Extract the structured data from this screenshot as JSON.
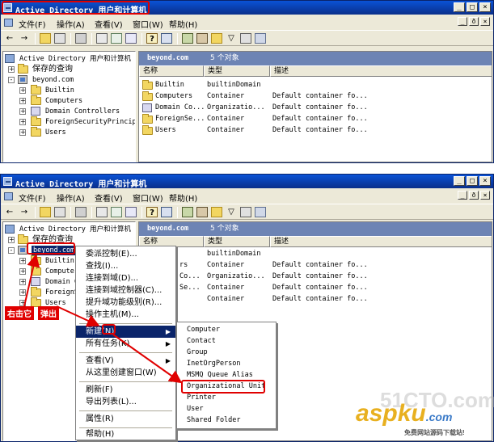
{
  "window": {
    "title": "Active Directory 用户和计算机",
    "controls": {
      "minimize": "_",
      "maximize": "□",
      "close": "×"
    },
    "inner_controls": {
      "minimize": "_",
      "restore": "ð",
      "close": "×"
    }
  },
  "menubar": {
    "items": [
      "文件(F)",
      "操作(A)",
      "查看(V)",
      "窗口(W)",
      "帮助(H)"
    ]
  },
  "toolbar": {
    "back": "←",
    "forward": "→"
  },
  "tree": {
    "root": "Active Directory 用户和计算机",
    "saved_queries": "保存的查询",
    "domain": "beyond.com",
    "children": [
      "Builtin",
      "Computers",
      "Domain Controllers",
      "ForeignSecurityPrincipa",
      "Users"
    ]
  },
  "tree2": {
    "children": [
      "Builtin",
      "Computer",
      "Domain C",
      "ForeignS",
      "Users"
    ]
  },
  "listview": {
    "header_domain": "beyond.com",
    "header_count": "5 个对象",
    "columns": [
      "名称",
      "类型",
      "描述"
    ],
    "rows": [
      {
        "name": "Builtin",
        "type": "builtinDomain",
        "desc": ""
      },
      {
        "name": "Computers",
        "type": "Container",
        "desc": "Default container fo..."
      },
      {
        "name": "Domain Co...",
        "type": "Organizatio...",
        "desc": "Default container fo..."
      },
      {
        "name": "ForeignSe...",
        "type": "Container",
        "desc": "Default container fo..."
      },
      {
        "name": "Users",
        "type": "Container",
        "desc": "Default container fo..."
      }
    ]
  },
  "listview2": {
    "rows": [
      {
        "name": "",
        "type": "builtinDomain",
        "desc": ""
      },
      {
        "name": "rs",
        "type": "Container",
        "desc": "Default container fo..."
      },
      {
        "name": "Co...",
        "type": "Organizatio...",
        "desc": "Default container fo..."
      },
      {
        "name": "Se...",
        "type": "Container",
        "desc": "Default container fo..."
      },
      {
        "name": "",
        "type": "Container",
        "desc": "Default container fo..."
      }
    ]
  },
  "context_menu": {
    "items": [
      "委派控制(E)...",
      "查找(I)...",
      "连接到域(D)...",
      "连接到域控制器(C)...",
      "提升域功能级别(R)...",
      "操作主机(M)..."
    ],
    "new_item": "新建(N)",
    "all_tasks": "所有任务(K)",
    "view": "查看(V)",
    "new_window": "从这里创建窗口(W)",
    "refresh": "刷新(F)",
    "export": "导出列表(L)...",
    "properties": "属性(R)",
    "help": "帮助(H)"
  },
  "submenu": {
    "items": [
      "Computer",
      "Contact",
      "Group",
      "InetOrgPerson",
      "MSMQ Queue Alias",
      "Organizational Unit",
      "Printer",
      "User",
      "Shared Folder"
    ]
  },
  "annotations": {
    "right_click": "右击它",
    "popup": "弹出"
  },
  "watermark": {
    "main": "aspku",
    "dot": ".com",
    "sub": "免费网站源码下载站!",
    "bg": "51CTO.com"
  },
  "colors": {
    "accent": "#e00000",
    "title_bar": "#0a52d6",
    "header": "#6d84b4",
    "selection": "#0a246a"
  }
}
